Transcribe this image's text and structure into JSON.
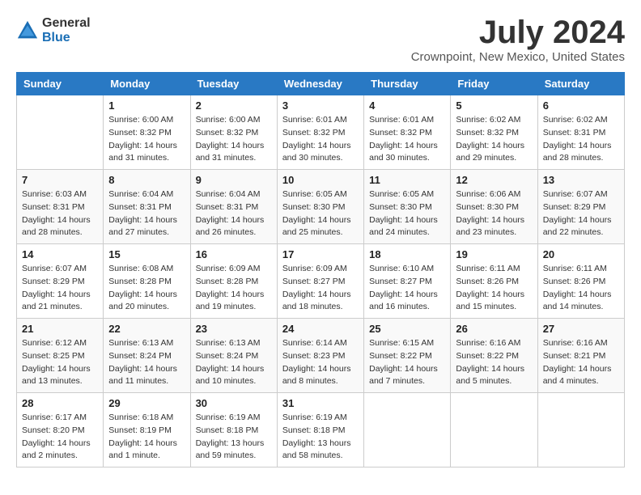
{
  "logo": {
    "general": "General",
    "blue": "Blue"
  },
  "title": "July 2024",
  "location": "Crownpoint, New Mexico, United States",
  "days_header": [
    "Sunday",
    "Monday",
    "Tuesday",
    "Wednesday",
    "Thursday",
    "Friday",
    "Saturday"
  ],
  "weeks": [
    [
      {
        "day": "",
        "sunrise": "",
        "sunset": "",
        "daylight": ""
      },
      {
        "day": "1",
        "sunrise": "Sunrise: 6:00 AM",
        "sunset": "Sunset: 8:32 PM",
        "daylight": "Daylight: 14 hours and 31 minutes."
      },
      {
        "day": "2",
        "sunrise": "Sunrise: 6:00 AM",
        "sunset": "Sunset: 8:32 PM",
        "daylight": "Daylight: 14 hours and 31 minutes."
      },
      {
        "day": "3",
        "sunrise": "Sunrise: 6:01 AM",
        "sunset": "Sunset: 8:32 PM",
        "daylight": "Daylight: 14 hours and 30 minutes."
      },
      {
        "day": "4",
        "sunrise": "Sunrise: 6:01 AM",
        "sunset": "Sunset: 8:32 PM",
        "daylight": "Daylight: 14 hours and 30 minutes."
      },
      {
        "day": "5",
        "sunrise": "Sunrise: 6:02 AM",
        "sunset": "Sunset: 8:32 PM",
        "daylight": "Daylight: 14 hours and 29 minutes."
      },
      {
        "day": "6",
        "sunrise": "Sunrise: 6:02 AM",
        "sunset": "Sunset: 8:31 PM",
        "daylight": "Daylight: 14 hours and 28 minutes."
      }
    ],
    [
      {
        "day": "7",
        "sunrise": "Sunrise: 6:03 AM",
        "sunset": "Sunset: 8:31 PM",
        "daylight": "Daylight: 14 hours and 28 minutes."
      },
      {
        "day": "8",
        "sunrise": "Sunrise: 6:04 AM",
        "sunset": "Sunset: 8:31 PM",
        "daylight": "Daylight: 14 hours and 27 minutes."
      },
      {
        "day": "9",
        "sunrise": "Sunrise: 6:04 AM",
        "sunset": "Sunset: 8:31 PM",
        "daylight": "Daylight: 14 hours and 26 minutes."
      },
      {
        "day": "10",
        "sunrise": "Sunrise: 6:05 AM",
        "sunset": "Sunset: 8:30 PM",
        "daylight": "Daylight: 14 hours and 25 minutes."
      },
      {
        "day": "11",
        "sunrise": "Sunrise: 6:05 AM",
        "sunset": "Sunset: 8:30 PM",
        "daylight": "Daylight: 14 hours and 24 minutes."
      },
      {
        "day": "12",
        "sunrise": "Sunrise: 6:06 AM",
        "sunset": "Sunset: 8:30 PM",
        "daylight": "Daylight: 14 hours and 23 minutes."
      },
      {
        "day": "13",
        "sunrise": "Sunrise: 6:07 AM",
        "sunset": "Sunset: 8:29 PM",
        "daylight": "Daylight: 14 hours and 22 minutes."
      }
    ],
    [
      {
        "day": "14",
        "sunrise": "Sunrise: 6:07 AM",
        "sunset": "Sunset: 8:29 PM",
        "daylight": "Daylight: 14 hours and 21 minutes."
      },
      {
        "day": "15",
        "sunrise": "Sunrise: 6:08 AM",
        "sunset": "Sunset: 8:28 PM",
        "daylight": "Daylight: 14 hours and 20 minutes."
      },
      {
        "day": "16",
        "sunrise": "Sunrise: 6:09 AM",
        "sunset": "Sunset: 8:28 PM",
        "daylight": "Daylight: 14 hours and 19 minutes."
      },
      {
        "day": "17",
        "sunrise": "Sunrise: 6:09 AM",
        "sunset": "Sunset: 8:27 PM",
        "daylight": "Daylight: 14 hours and 18 minutes."
      },
      {
        "day": "18",
        "sunrise": "Sunrise: 6:10 AM",
        "sunset": "Sunset: 8:27 PM",
        "daylight": "Daylight: 14 hours and 16 minutes."
      },
      {
        "day": "19",
        "sunrise": "Sunrise: 6:11 AM",
        "sunset": "Sunset: 8:26 PM",
        "daylight": "Daylight: 14 hours and 15 minutes."
      },
      {
        "day": "20",
        "sunrise": "Sunrise: 6:11 AM",
        "sunset": "Sunset: 8:26 PM",
        "daylight": "Daylight: 14 hours and 14 minutes."
      }
    ],
    [
      {
        "day": "21",
        "sunrise": "Sunrise: 6:12 AM",
        "sunset": "Sunset: 8:25 PM",
        "daylight": "Daylight: 14 hours and 13 minutes."
      },
      {
        "day": "22",
        "sunrise": "Sunrise: 6:13 AM",
        "sunset": "Sunset: 8:24 PM",
        "daylight": "Daylight: 14 hours and 11 minutes."
      },
      {
        "day": "23",
        "sunrise": "Sunrise: 6:13 AM",
        "sunset": "Sunset: 8:24 PM",
        "daylight": "Daylight: 14 hours and 10 minutes."
      },
      {
        "day": "24",
        "sunrise": "Sunrise: 6:14 AM",
        "sunset": "Sunset: 8:23 PM",
        "daylight": "Daylight: 14 hours and 8 minutes."
      },
      {
        "day": "25",
        "sunrise": "Sunrise: 6:15 AM",
        "sunset": "Sunset: 8:22 PM",
        "daylight": "Daylight: 14 hours and 7 minutes."
      },
      {
        "day": "26",
        "sunrise": "Sunrise: 6:16 AM",
        "sunset": "Sunset: 8:22 PM",
        "daylight": "Daylight: 14 hours and 5 minutes."
      },
      {
        "day": "27",
        "sunrise": "Sunrise: 6:16 AM",
        "sunset": "Sunset: 8:21 PM",
        "daylight": "Daylight: 14 hours and 4 minutes."
      }
    ],
    [
      {
        "day": "28",
        "sunrise": "Sunrise: 6:17 AM",
        "sunset": "Sunset: 8:20 PM",
        "daylight": "Daylight: 14 hours and 2 minutes."
      },
      {
        "day": "29",
        "sunrise": "Sunrise: 6:18 AM",
        "sunset": "Sunset: 8:19 PM",
        "daylight": "Daylight: 14 hours and 1 minute."
      },
      {
        "day": "30",
        "sunrise": "Sunrise: 6:19 AM",
        "sunset": "Sunset: 8:18 PM",
        "daylight": "Daylight: 13 hours and 59 minutes."
      },
      {
        "day": "31",
        "sunrise": "Sunrise: 6:19 AM",
        "sunset": "Sunset: 8:18 PM",
        "daylight": "Daylight: 13 hours and 58 minutes."
      },
      {
        "day": "",
        "sunrise": "",
        "sunset": "",
        "daylight": ""
      },
      {
        "day": "",
        "sunrise": "",
        "sunset": "",
        "daylight": ""
      },
      {
        "day": "",
        "sunrise": "",
        "sunset": "",
        "daylight": ""
      }
    ]
  ]
}
